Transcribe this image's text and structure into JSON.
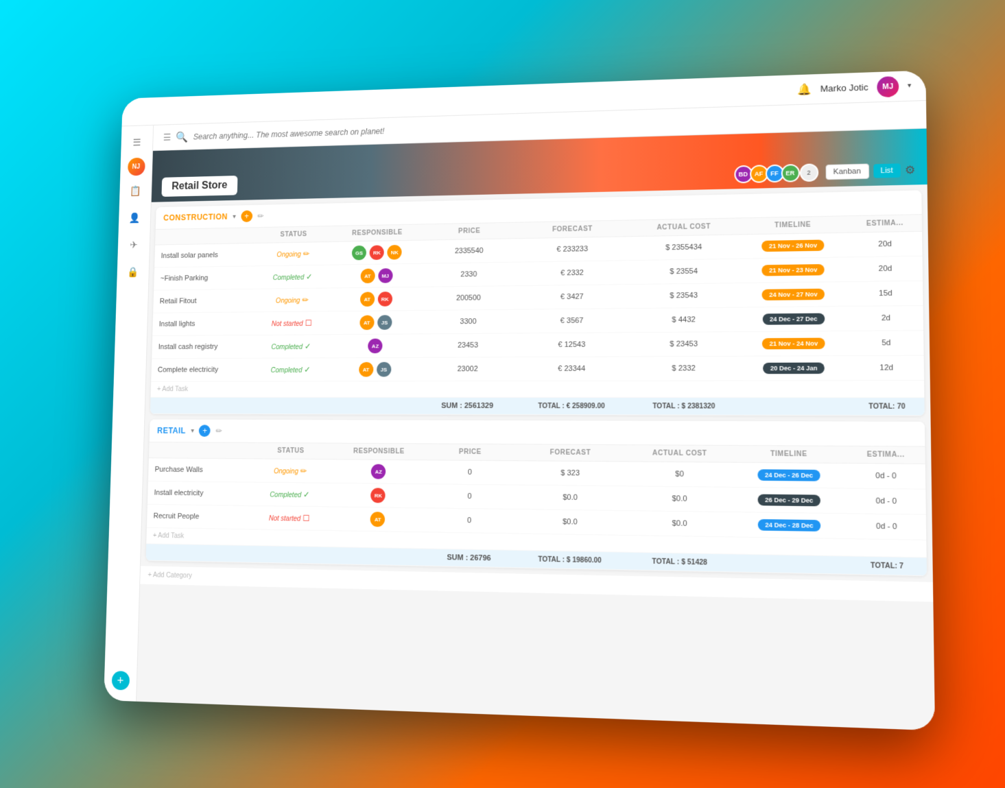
{
  "topbar": {
    "user": "Marko Jotic",
    "user_initials": "MJ"
  },
  "sidebar": {
    "icons": [
      "☰",
      "📋",
      "👤",
      "✈",
      "🔒",
      "+"
    ]
  },
  "search": {
    "placeholder": "Search anything... The most awesome search on planet!"
  },
  "project": {
    "title": "Retail Store",
    "view_kanban": "Kanban",
    "view_list": "List",
    "avatars": [
      {
        "initials": "BD",
        "color": "#9c27b0"
      },
      {
        "initials": "AF",
        "color": "#ff9800"
      },
      {
        "initials": "FF",
        "color": "#2196f3"
      },
      {
        "initials": "ER",
        "color": "#4caf50"
      }
    ],
    "more_count": "2"
  },
  "construction": {
    "label": "CONSTRUCTION",
    "columns": [
      "STATUS",
      "RESPONSIBLE",
      "PRICE",
      "FORECAST",
      "ACTUAL COST",
      "TIMELINE",
      "ESTIMA..."
    ],
    "tasks": [
      {
        "name": "Install solar panels",
        "status": "Ongoing",
        "status_type": "ongoing",
        "responsible_colors": [
          "#4caf50",
          "#f44336",
          "#ff9800"
        ],
        "price": "2335540",
        "forecast": "€ 233233",
        "actual_cost": "$ 2355434",
        "timeline": "21 Nov - 26 Nov",
        "timeline_type": "orange",
        "estimate": "20d"
      },
      {
        "name": "~Finish Parking",
        "status": "Completed",
        "status_type": "completed",
        "responsible_colors": [
          "#ff9800",
          "#9c27b0"
        ],
        "price": "2330",
        "forecast": "€ 2332",
        "actual_cost": "$ 23554",
        "timeline": "21 Nov - 23 Nov",
        "timeline_type": "orange",
        "estimate": "20d"
      },
      {
        "name": "Retail Fitout",
        "status": "Ongoing",
        "status_type": "ongoing",
        "responsible_colors": [
          "#ff9800",
          "#f44336"
        ],
        "price": "200500",
        "forecast": "€ 3427",
        "actual_cost": "$ 23543",
        "timeline": "24 Nov - 27 Nov",
        "timeline_type": "orange",
        "estimate": "15d"
      },
      {
        "name": "Install lights",
        "status": "Not started",
        "status_type": "notstarted",
        "responsible_colors": [
          "#ff9800",
          "#607d8b"
        ],
        "price": "3300",
        "forecast": "€ 3567",
        "actual_cost": "$ 4432",
        "timeline": "24 Dec - 27 Dec",
        "timeline_type": "dark",
        "estimate": "2d"
      },
      {
        "name": "Install cash registry",
        "status": "Completed",
        "status_type": "completed",
        "responsible_colors": [
          "#9c27b0"
        ],
        "responsible_initials": [
          "AZ"
        ],
        "price": "23453",
        "forecast": "€ 12543",
        "actual_cost": "$ 23453",
        "timeline": "21 Nov - 24 Nov",
        "timeline_type": "orange",
        "estimate": "5d"
      },
      {
        "name": "Complete electricity",
        "status": "Completed",
        "status_type": "completed",
        "responsible_colors": [
          "#ff9800",
          "#607d8b"
        ],
        "price": "23002",
        "forecast": "€ 23344",
        "actual_cost": "$ 2332",
        "timeline": "20 Dec - 24 Jan",
        "timeline_type": "dark",
        "estimate": "12d"
      }
    ],
    "sum_price": "SUM : 2561329",
    "total_forecast": "TOTAL : € 258909.00",
    "total_actual": "TOTAL : $ 2381320",
    "total_estimate": "TOTAL: 70"
  },
  "retail": {
    "label": "RETAIL",
    "columns": [
      "STATUS",
      "RESPONSIBLE",
      "PRICE",
      "FORECAST",
      "ACTUAL COST",
      "TIMELINE",
      "ESTIMA..."
    ],
    "tasks": [
      {
        "name": "Purchase Walls",
        "status": "Ongoing",
        "status_type": "ongoing",
        "responsible_initials": [
          "AZ"
        ],
        "responsible_colors": [
          "#9c27b0"
        ],
        "price": "0",
        "forecast": "$ 323",
        "actual_cost": "$0",
        "timeline": "24 Dec - 26 Dec",
        "timeline_type": "blue",
        "estimate": "0d - 0"
      },
      {
        "name": "Install electricity",
        "status": "Completed",
        "status_type": "completed",
        "responsible_colors": [
          "#f44336"
        ],
        "price": "0",
        "forecast": "$0.0",
        "actual_cost": "$0.0",
        "timeline": "26 Dec - 29 Dec",
        "timeline_type": "dark",
        "estimate": "0d - 0"
      },
      {
        "name": "Recruit People",
        "status": "Not started",
        "status_type": "notstarted",
        "responsible_initials": [
          "AT"
        ],
        "responsible_colors": [
          "#ff9800"
        ],
        "price": "0",
        "forecast": "$0.0",
        "actual_cost": "$0.0",
        "timeline": "24 Dec - 28 Dec",
        "timeline_type": "blue",
        "estimate": "0d - 0"
      }
    ],
    "sum_price": "SUM : 26796",
    "total_forecast": "TOTAL : $ 19860.00",
    "total_actual": "TOTAL : $ 51428",
    "total_estimate": "TOTAL: 7"
  },
  "add_task_label": "+ Add Task",
  "add_category_label": "+ Add Category"
}
